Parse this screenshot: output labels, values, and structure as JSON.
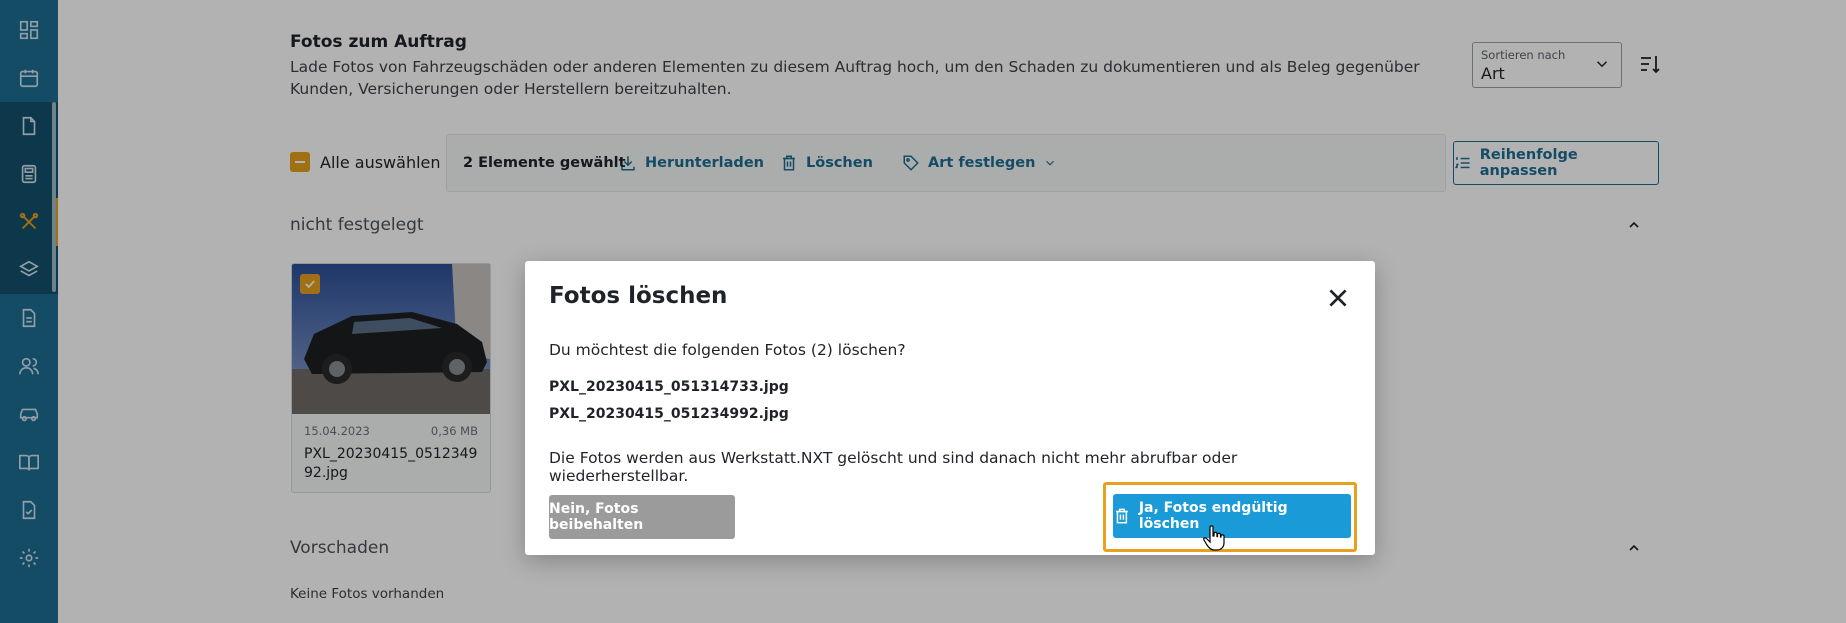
{
  "sidebar": {
    "items": [
      {
        "icon": "dashboard-icon"
      },
      {
        "icon": "calendar-icon"
      },
      {
        "icon": "document-icon"
      },
      {
        "icon": "calculator-icon"
      },
      {
        "icon": "tools-icon"
      },
      {
        "icon": "layers-icon"
      },
      {
        "icon": "invoice-icon"
      },
      {
        "icon": "users-icon"
      },
      {
        "icon": "car-icon"
      },
      {
        "icon": "book-icon"
      },
      {
        "icon": "file-check-icon"
      },
      {
        "icon": "gear-icon"
      }
    ],
    "active_color": "#e8a11d"
  },
  "page": {
    "title": "Fotos zum Auftrag",
    "description": "Lade Fotos von Fahrzeugschäden oder anderen Elementen zu diesem Auftrag hoch, um den Schaden zu dokumentieren und als Beleg gegenüber Kunden, Versicherungen oder Herstellern bereitzuhalten."
  },
  "sort": {
    "label": "Sortieren nach",
    "value": "Art"
  },
  "selection": {
    "select_all_label": "Alle auswählen",
    "count_label": "2 Elemente gewählt",
    "download_label": "Herunterladen",
    "delete_label": "Löschen",
    "set_type_label": "Art festlegen"
  },
  "order_button_label": "Reihenfolge anpassen",
  "sections": [
    {
      "title": "nicht festgelegt",
      "photos": [
        {
          "date": "15.04.2023",
          "size": "0,36 MB",
          "name": "PXL_20230415_051234992.jpg",
          "selected": true
        }
      ]
    },
    {
      "title": "Vorschaden",
      "empty_text": "Keine Fotos vorhanden"
    }
  ],
  "modal": {
    "title": "Fotos löschen",
    "question": "Du möchtest die folgenden Fotos (2) löschen?",
    "files": [
      "PXL_20230415_051314733.jpg",
      "PXL_20230415_051234992.jpg"
    ],
    "warning": "Die Fotos werden aus Werkstatt.NXT gelöscht und sind danach nicht mehr abrufbar oder wiederherstellbar.",
    "cancel_label": "Nein, Fotos beibehalten",
    "confirm_label": "Ja, Fotos endgültig löschen"
  },
  "colors": {
    "brand": "#1d6e93",
    "accent": "#e8a11d",
    "confirm": "#1a9ad6",
    "neutral_button": "#9b9b9b"
  }
}
